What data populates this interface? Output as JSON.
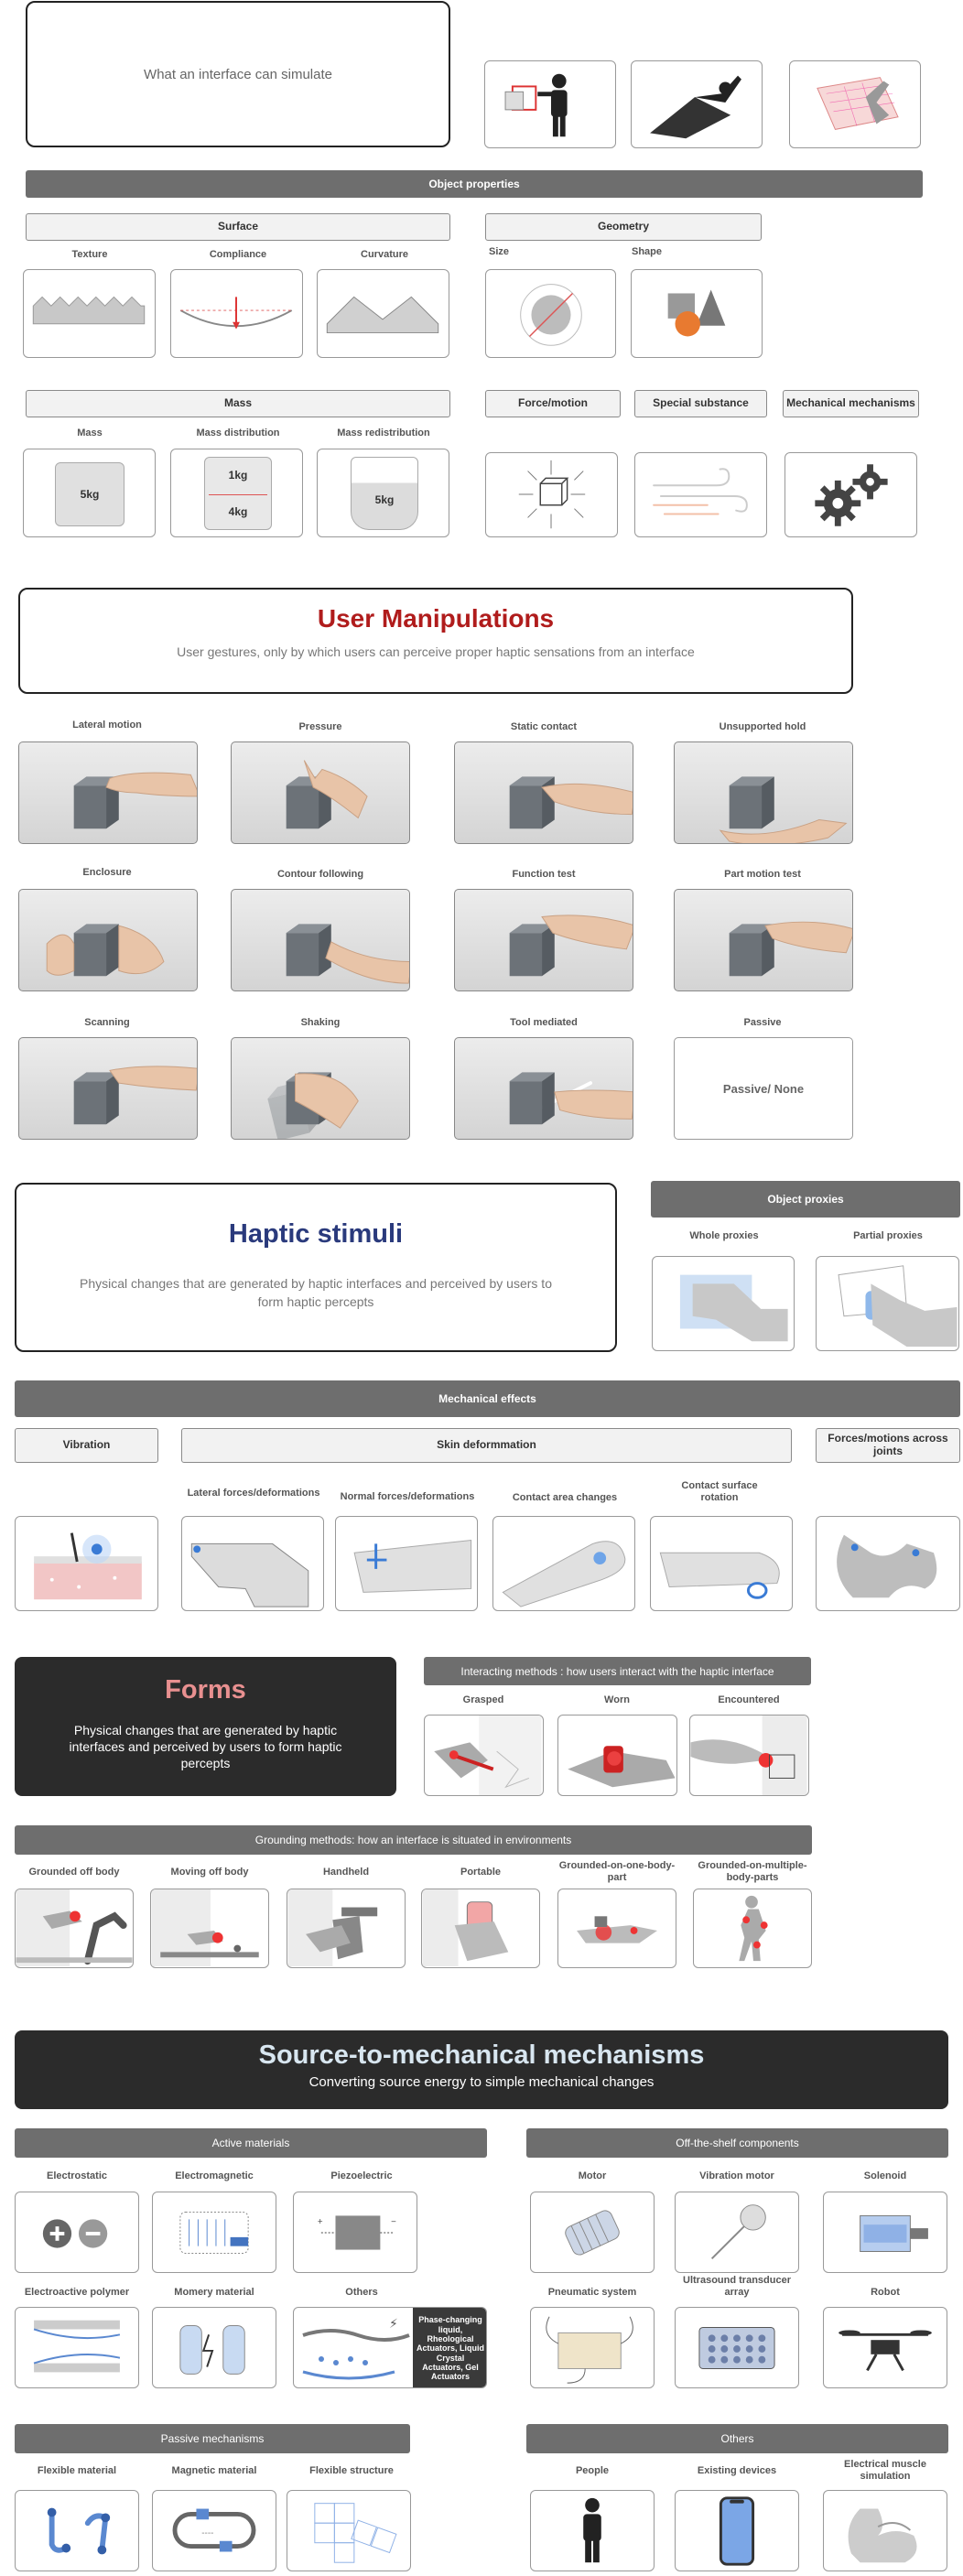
{
  "intro": {
    "title": "What an interface can simulate"
  },
  "object_properties": {
    "header": "Object properties",
    "surface": {
      "label": "Surface",
      "items": [
        "Texture",
        "Compliance",
        "Curvature"
      ]
    },
    "geometry": {
      "label": "Geometry",
      "items": [
        "Size",
        "Shape"
      ]
    },
    "mass": {
      "label": "Mass",
      "items": [
        "Mass",
        "Mass distribution",
        "Mass redistribution"
      ],
      "mass_value": "5kg",
      "dist_top": "1kg",
      "dist_bottom": "4kg",
      "redist_value": "5kg"
    },
    "force_motion": "Force/motion",
    "special_substance": "Special substance",
    "mechanical_mechanisms": "Mechanical mechanisms"
  },
  "manipulations": {
    "title": "User Manipulations",
    "subtitle": "User gestures, only by which users can perceive proper haptic sensations from an interface",
    "items": [
      "Lateral motion",
      "Pressure",
      "Static contact",
      "Unsupported hold",
      "Enclosure",
      "Contour following",
      "Function test",
      "Part motion test",
      "Scanning",
      "Shaking",
      "Tool mediated",
      "Passive"
    ],
    "passive_text": "Passive/ None"
  },
  "stimuli": {
    "title": "Haptic stimuli",
    "subtitle": "Physical changes that are generated by haptic interfaces and perceived by users to form haptic percepts",
    "object_proxies": "Object proxies",
    "whole_proxies": "Whole proxies",
    "partial_proxies": "Partial proxies",
    "mechanical_effects": "Mechanical effects",
    "vibration": "Vibration",
    "skin_deformation": "Skin deformmation",
    "forces_joints": "Forces/motions across joints",
    "lateral": "Lateral forces/deformations",
    "normal": "Normal forces/deformations",
    "contact_area": "Contact area changes",
    "contact_rotation": "Contact surface rotation"
  },
  "forms": {
    "title": "Forms",
    "subtitle": "Physical changes that are generated by haptic interfaces and perceived by users to form haptic percepts",
    "interacting_header": "Interacting methods : how users interact with the haptic interface",
    "interacting": [
      "Grasped",
      "Worn",
      "Encountered"
    ],
    "grounding_header": "Grounding methods: how an interface is situated in environments",
    "grounding": [
      "Grounded off body",
      "Moving off body",
      "Handheld",
      "Portable",
      "Grounded-on-one-body-part",
      "Grounded-on-multiple-body-parts"
    ]
  },
  "mechanisms": {
    "title": "Source-to-mechanical mechanisms",
    "subtitle": "Converting source energy to simple mechanical changes",
    "active_header": "Active materials",
    "active": [
      "Electrostatic",
      "Electromagnetic",
      "Piezoelectric",
      "Electroactive polymer",
      "Momery material",
      "Others"
    ],
    "others_text": "Phase-changing liquid, Rheological Actuators, Liquid Crystal Actuators, Gel Actuators",
    "shelf_header": "Off-the-shelf components",
    "shelf": [
      "Motor",
      "Vibration motor",
      "Solenoid",
      "Pneumatic system",
      "Ultrasound transducer array",
      "Robot"
    ],
    "passive_header": "Passive mechanisms",
    "passive": [
      "Flexible material",
      "Magnetic material",
      "Flexible structure"
    ],
    "others_header": "Others",
    "others": [
      "People",
      "Existing devices",
      "Electrical muscle simulation"
    ]
  },
  "colors": {
    "red_title": "#b01c1c",
    "navy_title": "#2a3a7c",
    "pink_title": "#e89090",
    "dark_panel": "#2b2b2b",
    "gray_bar": "#6e6e6e",
    "accent_red": "#d83030",
    "accent_blue": "#3a7bd5"
  }
}
